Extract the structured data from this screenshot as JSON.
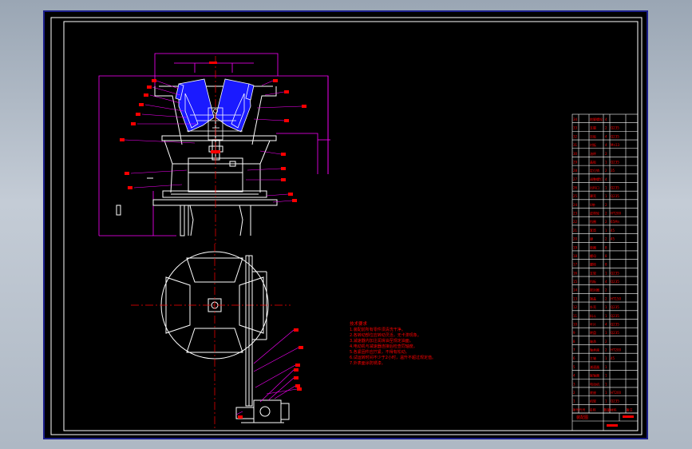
{
  "canvas": {
    "background": "#000000",
    "frame_color": "#ffffff",
    "line_color": "#ffffff",
    "dimension_color": "#ff00ff",
    "annotation_color": "#ff0000",
    "part_fill_color": "#1a1aff",
    "center_line_color": "#ff0000"
  },
  "notes": {
    "title": "技术要求",
    "lines": [
      "1.装配前所有零件须清洗干净。",
      "2.各转动部位应转动灵活，无卡滞现象。",
      "3.减速器内加注润滑油至规定油面。",
      "4.电动机与减速器连接后检查同轴度。",
      "5.各紧固件应拧紧，不得有松动。",
      "6.试运转时间不少于2小时，温升不超过规定值。",
      "7.外表面涂防锈漆。"
    ]
  },
  "parts_table": {
    "columns": [
      "序号",
      "代号",
      "名称",
      "数量",
      "材料",
      "备注"
    ],
    "rows": [
      {
        "no": "1",
        "code": "",
        "name": "机架",
        "qty": "1",
        "material": "Q235"
      },
      {
        "no": "2",
        "code": "",
        "name": "底座",
        "qty": "1",
        "material": "HT200"
      },
      {
        "no": "3",
        "code": "",
        "name": "电动机",
        "qty": "1",
        "material": ""
      },
      {
        "no": "4",
        "code": "",
        "name": "联轴器",
        "qty": "1",
        "material": ""
      },
      {
        "no": "5",
        "code": "",
        "name": "减速器",
        "qty": "1",
        "material": ""
      },
      {
        "no": "6",
        "code": "",
        "name": "主轴",
        "qty": "1",
        "material": "45"
      },
      {
        "no": "7",
        "code": "",
        "name": "轴承座",
        "qty": "2",
        "material": "HT200"
      },
      {
        "no": "8",
        "code": "",
        "name": "轴承",
        "qty": "2",
        "material": ""
      },
      {
        "no": "9",
        "code": "",
        "name": "转盘",
        "qty": "1",
        "material": "Q235"
      },
      {
        "no": "10",
        "code": "",
        "name": "叶片",
        "qty": "4",
        "material": "Q235"
      },
      {
        "no": "11",
        "code": "",
        "name": "料斗",
        "qty": "1",
        "material": "Q235"
      },
      {
        "no": "12",
        "code": "",
        "name": "外壳",
        "qty": "1",
        "material": "Q235"
      },
      {
        "no": "13",
        "code": "",
        "name": "端盖",
        "qty": "2",
        "material": "HT150"
      },
      {
        "no": "14",
        "code": "",
        "name": "密封圈",
        "qty": "2",
        "material": ""
      },
      {
        "no": "15",
        "code": "",
        "name": "挡板",
        "qty": "4",
        "material": "Q235"
      },
      {
        "no": "16",
        "code": "",
        "name": "支架",
        "qty": "1",
        "material": "Q235"
      },
      {
        "no": "17",
        "code": "",
        "name": "螺栓",
        "qty": "8",
        "material": ""
      },
      {
        "no": "18",
        "code": "",
        "name": "螺母",
        "qty": "8",
        "material": ""
      },
      {
        "no": "19",
        "code": "",
        "name": "垫圈",
        "qty": "8",
        "material": ""
      },
      {
        "no": "20",
        "code": "",
        "name": "键",
        "qty": "2",
        "material": "45"
      },
      {
        "no": "21",
        "code": "",
        "name": "套筒",
        "qty": "1",
        "material": "45"
      },
      {
        "no": "22",
        "code": "",
        "name": "挡圈",
        "qty": "2",
        "material": "65Mn"
      },
      {
        "no": "23",
        "code": "",
        "name": "皮带轮",
        "qty": "2",
        "material": "HT200"
      },
      {
        "no": "24",
        "code": "",
        "name": "V带",
        "qty": "2",
        "material": ""
      },
      {
        "no": "25",
        "code": "",
        "name": "罩壳",
        "qty": "1",
        "material": "Q235"
      },
      {
        "no": "26",
        "code": "",
        "name": "出料口",
        "qty": "1",
        "material": "Q235"
      },
      {
        "no": "27",
        "code": "",
        "name": "调整螺钉",
        "qty": "4",
        "material": ""
      },
      {
        "no": "28",
        "code": "",
        "name": "定位销",
        "qty": "2",
        "material": "35"
      },
      {
        "no": "29",
        "code": "",
        "name": "盖板",
        "qty": "1",
        "material": "Q235"
      },
      {
        "no": "30",
        "code": "",
        "name": "油杯",
        "qty": "2",
        "material": ""
      },
      {
        "no": "31",
        "code": "",
        "name": "衬板",
        "qty": "4",
        "material": "Mn13"
      },
      {
        "no": "32",
        "code": "",
        "name": "压板",
        "qty": "4",
        "material": "Q235"
      },
      {
        "no": "33",
        "code": "",
        "name": "支腿",
        "qty": "2",
        "material": "Q235"
      },
      {
        "no": "34",
        "code": "",
        "name": "地脚螺栓",
        "qty": "4",
        "material": ""
      }
    ]
  },
  "title_block": {
    "drawing_name": "装配图"
  }
}
